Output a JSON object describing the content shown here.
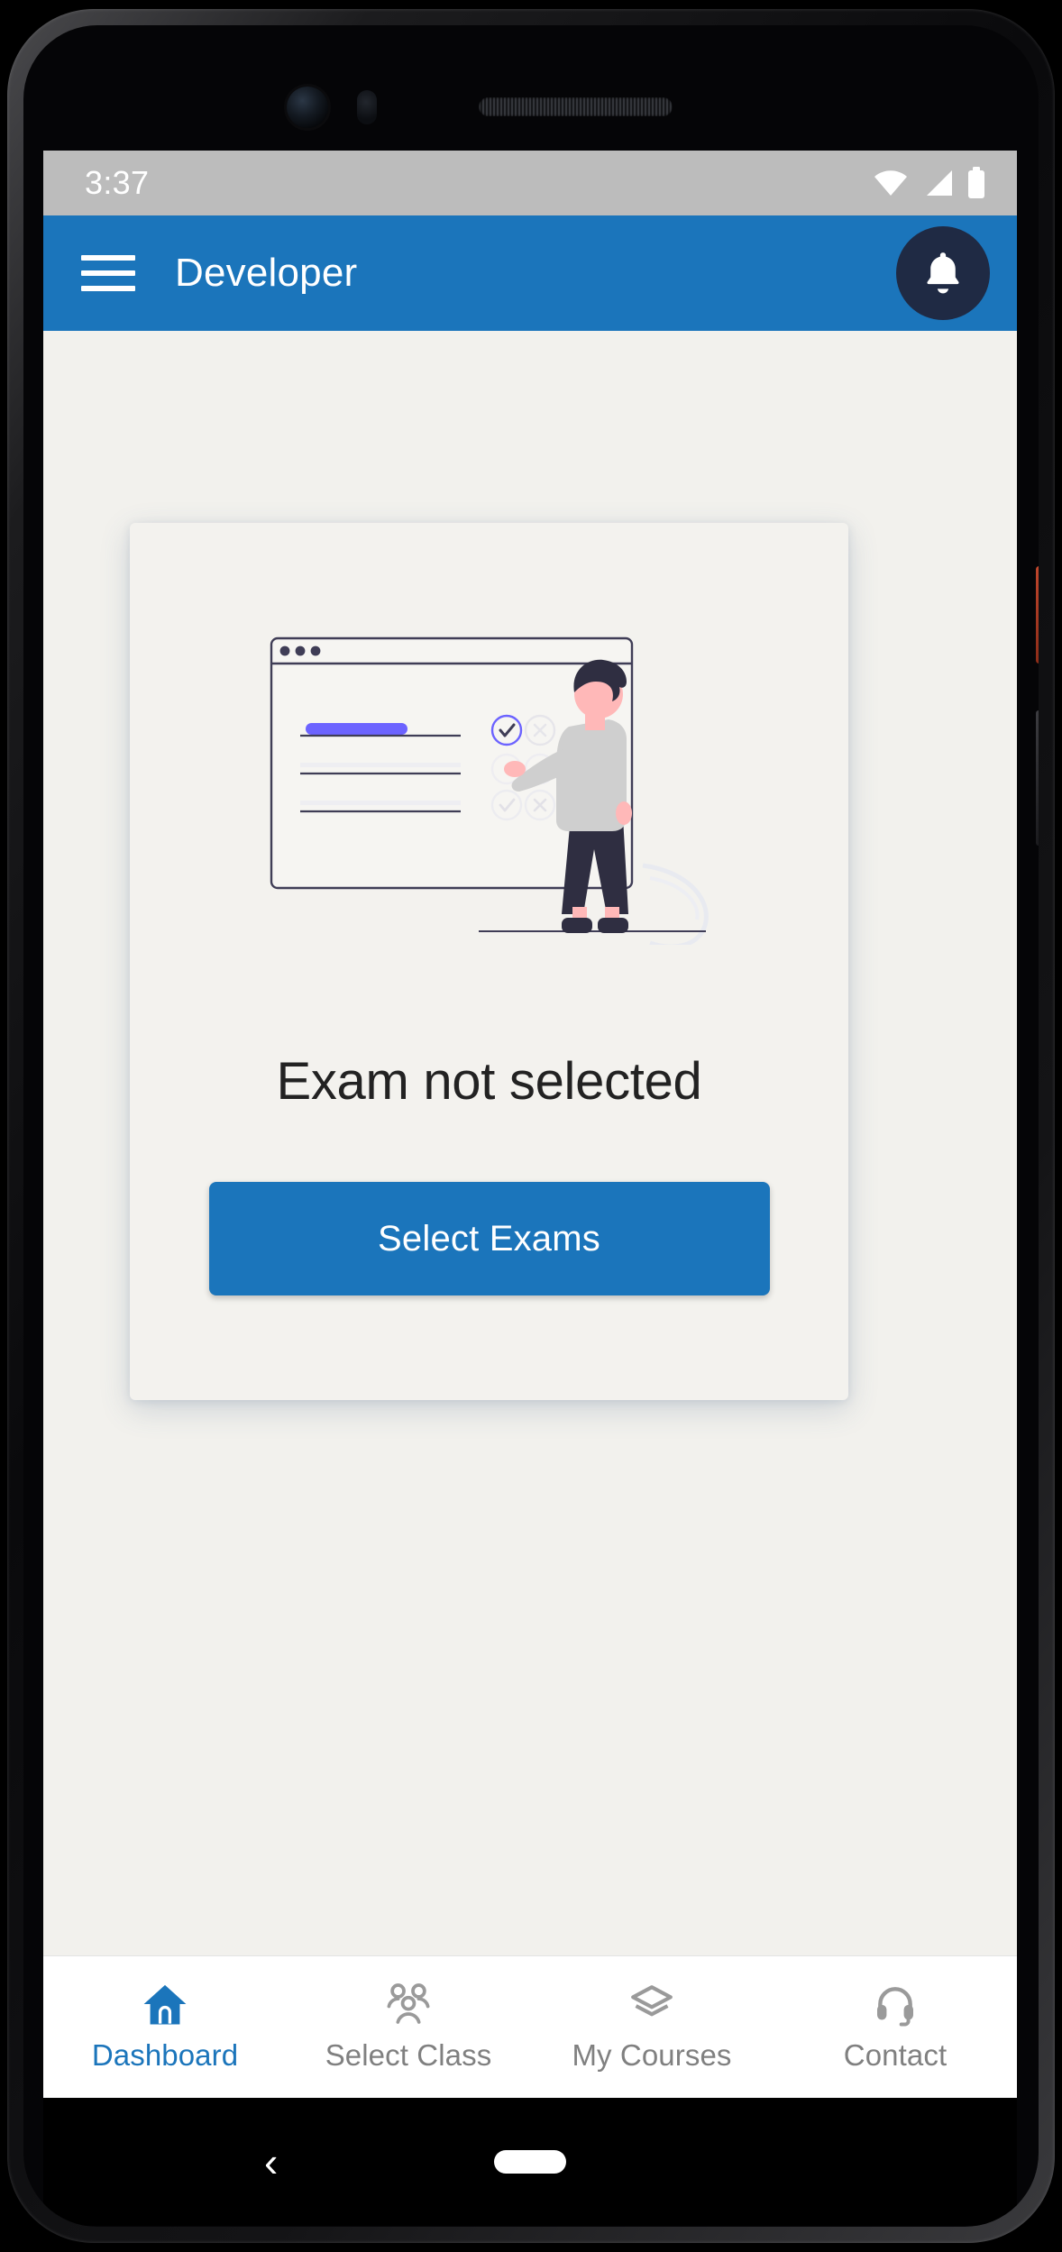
{
  "status_bar": {
    "time": "3:37",
    "icons": [
      "wifi-icon",
      "cellular-signal-icon",
      "battery-icon"
    ]
  },
  "app_bar": {
    "title": "Developer",
    "menu_icon": "hamburger-menu-icon",
    "notification_icon": "bell-icon",
    "background_color": "#1b75bb",
    "notification_button_color": "#1f2a44"
  },
  "empty_state": {
    "illustration": "person-reviewing-checklist-illustration",
    "title": "Exam not selected",
    "button_label": "Select Exams",
    "button_color": "#1b75bb"
  },
  "bottom_nav": {
    "active_color": "#1b75bb",
    "inactive_color": "#808080",
    "items": [
      {
        "label": "Dashboard",
        "icon": "home-icon",
        "active": true
      },
      {
        "label": "Select Class",
        "icon": "group-people-icon",
        "active": false
      },
      {
        "label": "My Courses",
        "icon": "layers-icon",
        "active": false
      },
      {
        "label": "Contact",
        "icon": "headset-icon",
        "active": false
      }
    ]
  },
  "system_nav": {
    "back_glyph": "‹",
    "home_pill": "home-pill"
  }
}
